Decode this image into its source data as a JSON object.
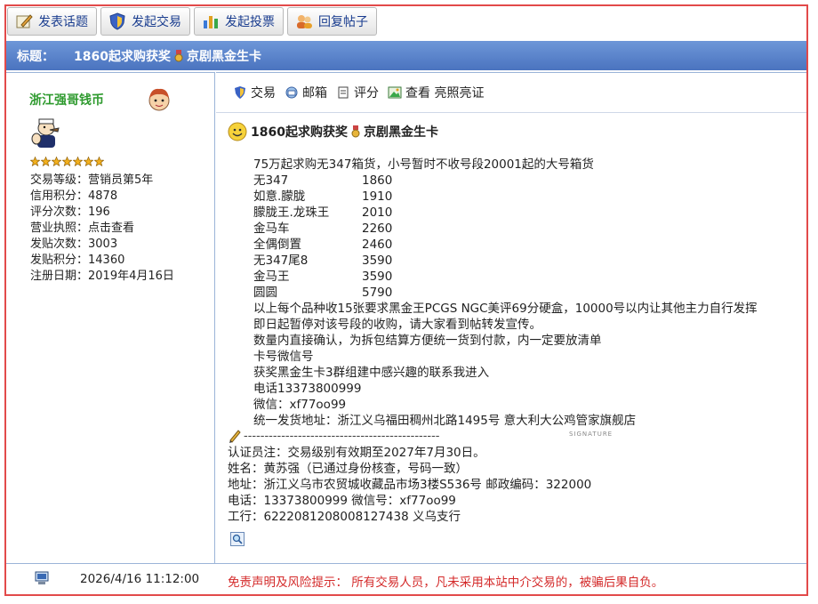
{
  "toolbar": {
    "btn_new_topic": "发表话题",
    "btn_new_trade": "发起交易",
    "btn_new_poll": "发起投票",
    "btn_reply": "回复帖子"
  },
  "thread": {
    "title_label": "标题：",
    "title_a": "1860起求购获奖",
    "title_b": "京剧黑金生卡"
  },
  "user": {
    "name": "浙江强哥钱币",
    "stars": 7,
    "info": [
      {
        "label": "交易等级：",
        "value": "营销员第5年"
      },
      {
        "label": "信用积分：",
        "value": "4878"
      },
      {
        "label": "评分次数：",
        "value": "196"
      },
      {
        "label": "营业执照：",
        "value": "点击查看"
      },
      {
        "label": "发贴次数：",
        "value": "3003"
      },
      {
        "label": "发贴积分：",
        "value": "14360"
      },
      {
        "label": "注册日期：",
        "value": "2019年4月16日"
      }
    ]
  },
  "actions": {
    "trade": "交易",
    "mailbox": "邮箱",
    "rate": "评分",
    "view_license": "查看 亮照亮证"
  },
  "post": {
    "head_a": "1860起求购获奖",
    "head_b": "京剧黑金生卡",
    "intro": "75万起求购无347箱货，小号暂时不收号段20001起的大号箱货",
    "prices": [
      {
        "name": "无347",
        "price": "1860"
      },
      {
        "name": "如意.朦胧",
        "price": "1910"
      },
      {
        "name": "朦胧王.龙珠王",
        "price": "2010"
      },
      {
        "name": "金马车",
        "price": "2260"
      },
      {
        "name": "全偶倒置",
        "price": "2460"
      },
      {
        "name": "无347尾8",
        "price": "3590"
      },
      {
        "name": "金马王",
        "price": "3590"
      },
      {
        "name": "圆圆",
        "price": "5790"
      }
    ],
    "lines": [
      "以上每个品种收15张要求黑金王PCGS NGC美评69分硬盒，10000号以内让其他主力自行发挥",
      "即日起暂停对该号段的收购，请大家看到帖转发宣传。",
      "数量内直接确认，为拆包结算方便统一货到付款，内一定要放清单",
      "卡号微信号",
      "获奖黑金生卡3群组建中感兴趣的联系我进入",
      "电话13373800999",
      "微信：xf77oo99",
      "统一发货地址：浙江义乌福田稠州北路1495号 意大利大公鸡管家旗舰店"
    ]
  },
  "signature": {
    "dashes": "-----------------------------------------------",
    "watermark": "SIGNATURE",
    "lines": [
      "认证员注：交易级别有效期至2027年7月30日。",
      "姓名：黄苏强（已通过身份核查，号码一致）",
      "地址：浙江义乌市农贸城收藏品市场3楼S536号   邮政编码：322000",
      "电话：13373800999  微信号：xf77oo99",
      "工行：6222081208008127438   义乌支行"
    ]
  },
  "footer": {
    "datetime": "2026/4/16 11:12:00",
    "disclaimer_label": "免责声明及风险提示：",
    "disclaimer_text": "所有交易人员，凡未采用本站中介交易的，被骗后果自负。"
  },
  "colors": {
    "title_bar": "#5a82cc",
    "username": "#2e9a2e",
    "disclaimer": "#d42a2a",
    "frame": "#e24a4a"
  }
}
